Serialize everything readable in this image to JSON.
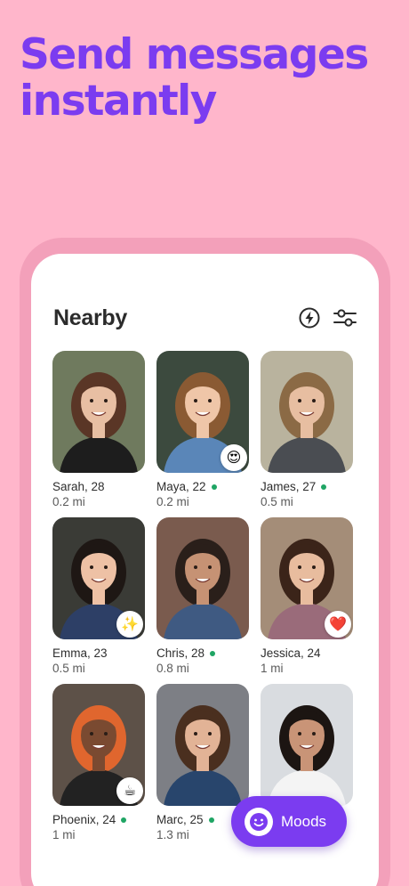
{
  "headline": "Send messages instantly",
  "screen": {
    "title": "Nearby",
    "icons": [
      "boost-bolt-icon",
      "filters-sliders-icon"
    ]
  },
  "moods_button": {
    "label": "Moods",
    "icon": "smiley-face-icon"
  },
  "colors": {
    "background": "#ffb6cb",
    "brand_purple": "#7b3cf0",
    "online_green": "#1fa564",
    "heart_red": "#e52b4b"
  },
  "profiles": [
    {
      "name": "Sarah, 28",
      "distance": "0.2 mi",
      "online": false,
      "badge": null
    },
    {
      "name": "Maya, 22",
      "distance": "0.2 mi",
      "online": true,
      "badge": "😍"
    },
    {
      "name": "James, 27",
      "distance": "0.5 mi",
      "online": true,
      "badge": null
    },
    {
      "name": "Emma, 23",
      "distance": "0.5 mi",
      "online": false,
      "badge": "✨"
    },
    {
      "name": "Chris, 28",
      "distance": "0.8 mi",
      "online": true,
      "badge": null
    },
    {
      "name": "Jessica, 24",
      "distance": "1 mi",
      "online": false,
      "badge": "❤️"
    },
    {
      "name": "Phoenix, 24",
      "distance": "1 mi",
      "online": true,
      "badge": "☕"
    },
    {
      "name": "Marc, 25",
      "distance": "1.3 mi",
      "online": true,
      "badge": null
    },
    {
      "name": "",
      "distance": "",
      "online": false,
      "badge": null
    }
  ]
}
